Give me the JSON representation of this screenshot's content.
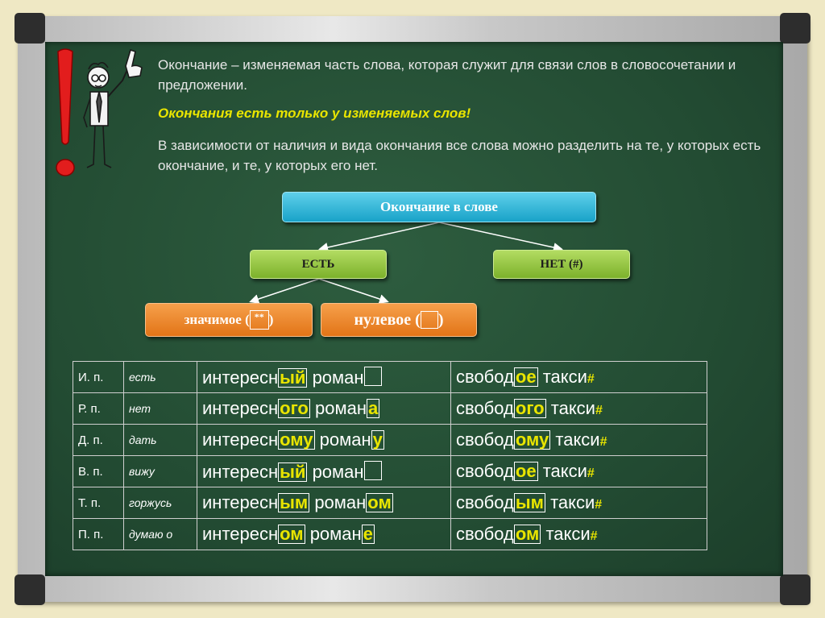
{
  "intro": {
    "p1": "Окончание – изменяемая часть слова, которая служит для связи слов  в словосочетании и предложении.",
    "p2": "Окончания есть только у изменяемых слов!",
    "p3": "В зависимости от наличия и вида окончания все слова можно разделить на те, у которых есть окончание, и те, у которых его нет."
  },
  "diagram": {
    "root": "Окончание в слове",
    "yes": "ЕСТЬ",
    "no": "НЕТ (#)",
    "significant_pre": "значимое (",
    "significant_mark": "**",
    "significant_post": ")",
    "zero_pre": "нулевое (",
    "zero_post": ")"
  },
  "table": {
    "rows": [
      {
        "case": "И. п.",
        "verb": "есть",
        "adj_stem": "интересн",
        "adj_end": "ый",
        "noun_stem": "роман",
        "noun_end": "",
        "neut_stem": "свобод",
        "neut_end": "ое",
        "taxi": "такси",
        "zero": "#"
      },
      {
        "case": "Р. п.",
        "verb": "нет",
        "adj_stem": "интересн",
        "adj_end": "ого",
        "noun_stem": "роман",
        "noun_end": "а",
        "neut_stem": "свобод",
        "neut_end": "ого",
        "taxi": "такси",
        "zero": "#"
      },
      {
        "case": "Д. п.",
        "verb": "дать",
        "adj_stem": "интересн",
        "adj_end": "ому",
        "noun_stem": "роман",
        "noun_end": "у",
        "neut_stem": "свобод",
        "neut_end": "ому",
        "taxi": "такси",
        "zero": "#"
      },
      {
        "case": "В. п.",
        "verb": "вижу",
        "adj_stem": "интересн",
        "adj_end": "ый",
        "noun_stem": "роман",
        "noun_end": "",
        "neut_stem": "свобод",
        "neut_end": "ое",
        "taxi": "такси",
        "zero": "#"
      },
      {
        "case": "Т. п.",
        "verb": "горжусь",
        "adj_stem": "интересн",
        "adj_end": "ым",
        "noun_stem": "роман",
        "noun_end": "ом",
        "neut_stem": "свобод",
        "neut_end": "ым",
        "taxi": "такси",
        "zero": "#"
      },
      {
        "case": "П. п.",
        "verb": "думаю о",
        "adj_stem": "интересн",
        "adj_end": "ом",
        "noun_stem": "роман",
        "noun_end": "е",
        "neut_stem": "свобод",
        "neut_end": "ом",
        "taxi": "такси",
        "zero": "#"
      }
    ]
  },
  "colors": {
    "board": "#234c33",
    "accent": "#e9e500",
    "frame": "#c8c8c8"
  }
}
